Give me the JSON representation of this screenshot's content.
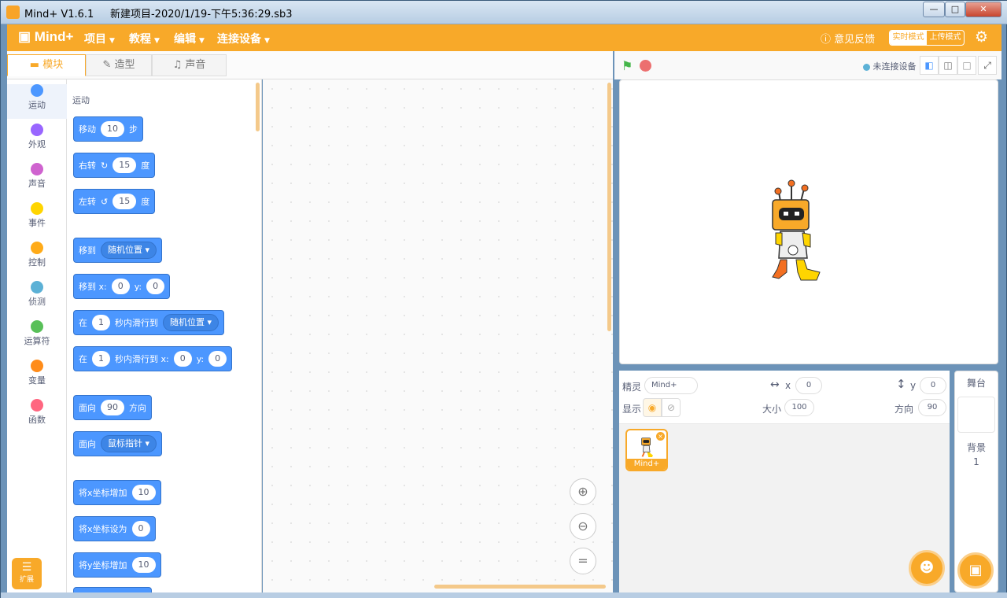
{
  "window": {
    "title": "Mind+ V1.6.1     新建项目-2020/1/19-下午5:36:29.sb3"
  },
  "menubar": {
    "logo": "Mind+",
    "menus": [
      "项目",
      "教程",
      "编辑",
      "连接设备"
    ],
    "feedback": "意见反馈",
    "mode_realtime": "实时模式",
    "mode_upload": "上传模式"
  },
  "tabs": [
    "模块",
    "造型",
    "声音"
  ],
  "categories": [
    {
      "label": "运动",
      "color": "#4c97ff"
    },
    {
      "label": "外观",
      "color": "#9966ff"
    },
    {
      "label": "声音",
      "color": "#cf63cf"
    },
    {
      "label": "事件",
      "color": "#ffd500"
    },
    {
      "label": "控制",
      "color": "#ffab19"
    },
    {
      "label": "侦测",
      "color": "#5cb1d6"
    },
    {
      "label": "运算符",
      "color": "#59c059"
    },
    {
      "label": "变量",
      "color": "#ff8c1a"
    },
    {
      "label": "函数",
      "color": "#ff6680"
    }
  ],
  "extension_label": "扩展",
  "palette": {
    "section": "运动",
    "blocks": {
      "move": {
        "a": "移动",
        "v": "10",
        "b": "步"
      },
      "turn_right": {
        "a": "右转",
        "v": "15",
        "b": "度"
      },
      "turn_left": {
        "a": "左转",
        "v": "15",
        "b": "度"
      },
      "goto": {
        "a": "移到",
        "dd": "随机位置"
      },
      "goto_xy": {
        "a": "移到 x:",
        "x": "0",
        "y_label": "y:",
        "y": "0"
      },
      "glide": {
        "a": "在",
        "v": "1",
        "b": "秒内滑行到",
        "dd": "随机位置"
      },
      "glide_xy": {
        "a": "在",
        "v": "1",
        "b": "秒内滑行到 x:",
        "x": "0",
        "y_label": "y:",
        "y": "0"
      },
      "point_dir": {
        "a": "面向",
        "v": "90",
        "b": "方向"
      },
      "point_towards": {
        "a": "面向",
        "dd": "鼠标指针"
      },
      "change_x": {
        "a": "将x坐标增加",
        "v": "10"
      },
      "set_x": {
        "a": "将x坐标设为",
        "v": "0"
      },
      "change_y": {
        "a": "将y坐标增加",
        "v": "10"
      }
    }
  },
  "stage": {
    "device_status": "未连接设备"
  },
  "sprite_info": {
    "sprite_label": "精灵",
    "sprite_name": "Mind+",
    "x_label": "x",
    "x": "0",
    "y_label": "y",
    "y": "0",
    "show_label": "显示",
    "size_label": "大小",
    "size": "100",
    "direction_label": "方向",
    "direction": "90"
  },
  "sprite_list": [
    {
      "name": "Mind+"
    }
  ],
  "stage_panel": {
    "title": "舞台",
    "backdrop_label": "背景",
    "backdrop_count": "1"
  }
}
